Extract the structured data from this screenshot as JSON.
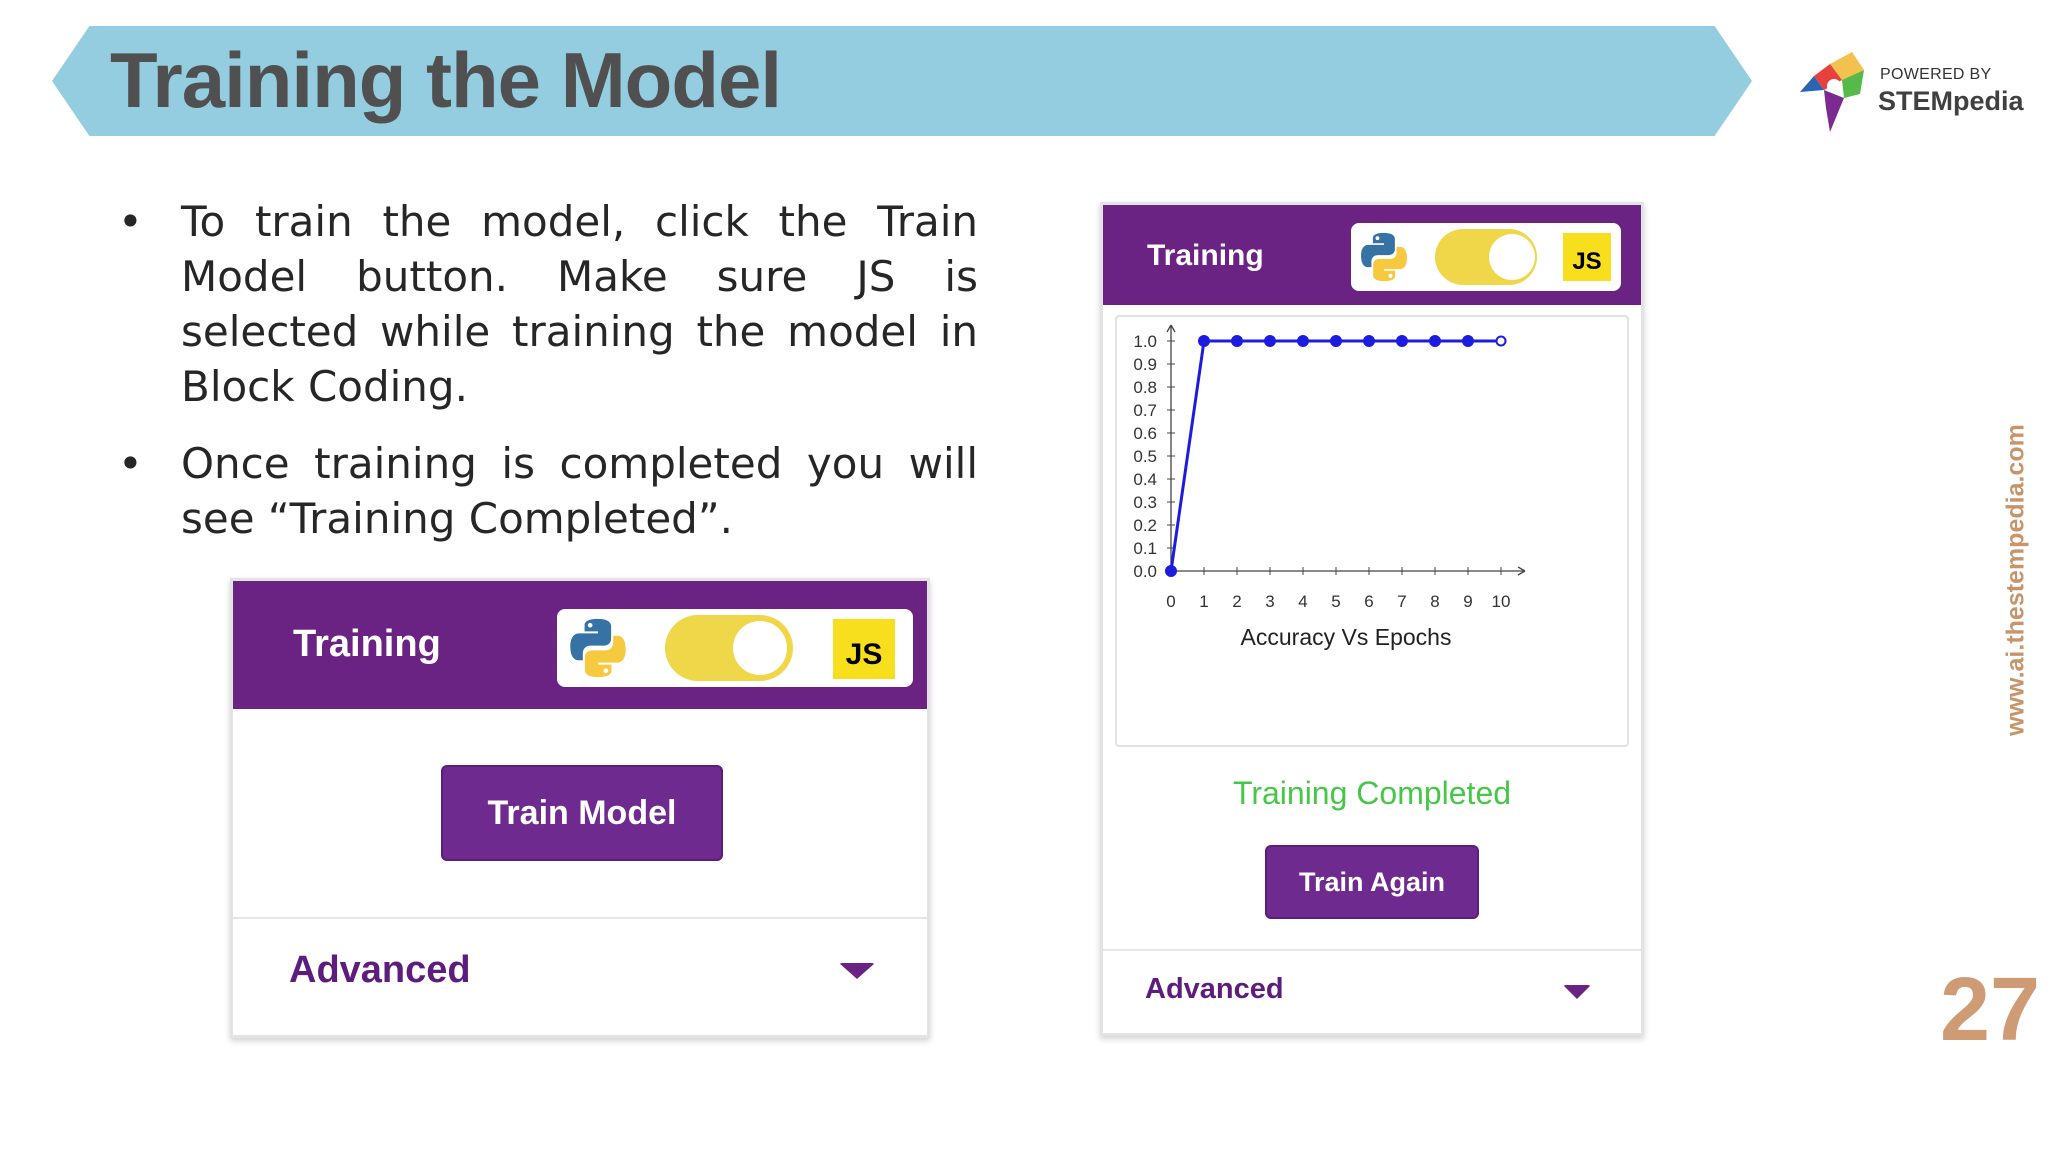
{
  "slide": {
    "title": "Training the Model",
    "bullets": [
      "To train the model, click the Train Model button. Make sure JS is selected while training the model in Block Coding.",
      "Once training is completed you will see “Training Completed”."
    ],
    "bullet_symbol": "•",
    "website": "www.ai.thestempedia.com",
    "page_number": "27"
  },
  "logo": {
    "powered_by": "POWERED BY",
    "name": "STEMpedia"
  },
  "panel_left": {
    "header_title": "Training",
    "js_label": "JS",
    "train_button": "Train Model",
    "advanced_label": "Advanced"
  },
  "panel_right": {
    "header_title": "Training",
    "js_label": "JS",
    "status": "Training Completed",
    "train_again_button": "Train Again",
    "advanced_label": "Advanced"
  },
  "colors": {
    "banner": "#94cde0",
    "panel_header": "#6a2283",
    "button": "#6e2a8e",
    "status_green": "#47c747",
    "line_blue": "#1c1ce0",
    "accent_tan": "#cf9b74"
  },
  "chart_data": {
    "type": "line",
    "title": "",
    "xlabel": "Accuracy Vs Epochs",
    "ylabel": "",
    "x": [
      0,
      1,
      2,
      3,
      4,
      5,
      6,
      7,
      8,
      9,
      10
    ],
    "series": [
      {
        "values": [
          0.0,
          1.0,
          1.0,
          1.0,
          1.0,
          1.0,
          1.0,
          1.0,
          1.0,
          1.0,
          1.0
        ]
      }
    ],
    "xticks": [
      "0",
      "1",
      "2",
      "3",
      "4",
      "5",
      "6",
      "7",
      "8",
      "9",
      "10"
    ],
    "yticks": [
      "0.0",
      "0.1",
      "0.2",
      "0.3",
      "0.4",
      "0.5",
      "0.6",
      "0.7",
      "0.8",
      "0.9",
      "1.0"
    ],
    "xlim": [
      0,
      10
    ],
    "ylim": [
      0,
      1.0
    ],
    "grid": false,
    "legend": "none"
  }
}
